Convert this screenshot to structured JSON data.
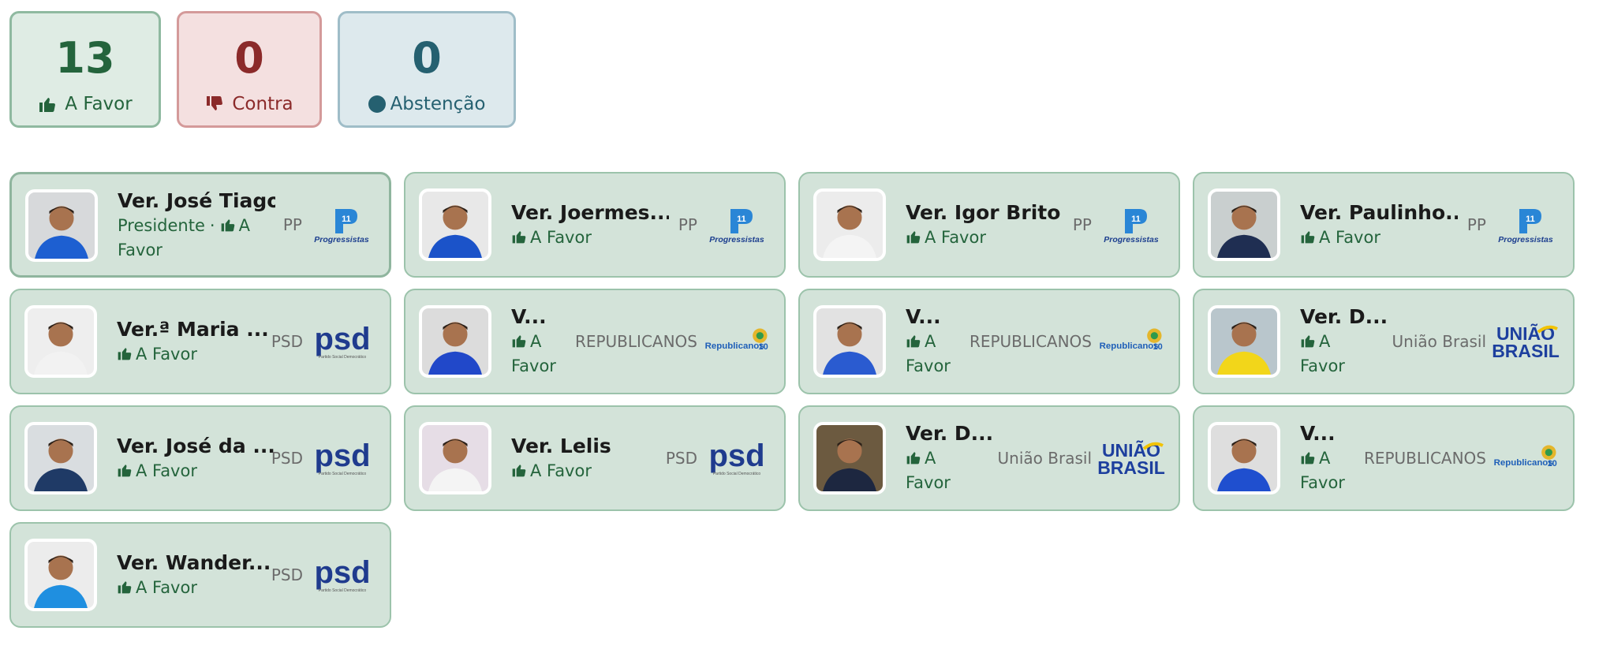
{
  "tally": {
    "favor": {
      "count": "13",
      "label": "A Favor"
    },
    "contra": {
      "count": "0",
      "label": "Contra"
    },
    "abstencao": {
      "count": "0",
      "label": "Abstenção"
    }
  },
  "colors": {
    "favor": "#24643c",
    "contra": "#8b2a2a",
    "abstencao": "#256070",
    "card_bg": "#d3e3d9",
    "card_border": "#9cc3ab"
  },
  "vote_sep": "·",
  "councillors": [
    {
      "name": "Ver. José Tiago",
      "role": "Presidente",
      "vote": "A Favor",
      "party": "PP",
      "logo": "progressistas-logo"
    },
    {
      "name": "Ver. Joermes...",
      "vote": "A Favor",
      "party": "PP",
      "logo": "progressistas-logo"
    },
    {
      "name": "Ver. Igor Brito",
      "vote": "A Favor",
      "party": "PP",
      "logo": "progressistas-logo"
    },
    {
      "name": "Ver. Paulinho...",
      "vote": "A Favor",
      "party": "PP",
      "logo": "progressistas-logo"
    },
    {
      "name": "Ver.ª Maria ...",
      "vote": "A Favor",
      "party": "PSD",
      "logo": "psd-logo"
    },
    {
      "name": "V...",
      "vote": "A Favor",
      "party": "REPUBLICANOS",
      "logo": "republicanos-logo"
    },
    {
      "name": "V...",
      "vote": "A Favor",
      "party": "REPUBLICANOS",
      "logo": "republicanos-logo"
    },
    {
      "name": "Ver. D...",
      "vote": "A Favor",
      "party": "União Brasil",
      "logo": "uniao-brasil-logo"
    },
    {
      "name": "Ver. José da ...",
      "vote": "A Favor",
      "party": "PSD",
      "logo": "psd-logo"
    },
    {
      "name": "Ver. Lelis",
      "vote": "A Favor",
      "party": "PSD",
      "logo": "psd-logo"
    },
    {
      "name": "Ver. D...",
      "vote": "A Favor",
      "party": "União Brasil",
      "logo": "uniao-brasil-logo"
    },
    {
      "name": "V...",
      "vote": "A Favor",
      "party": "REPUBLICANOS",
      "logo": "republicanos-logo"
    },
    {
      "name": "Ver. Wander...",
      "vote": "A Favor",
      "party": "PSD",
      "logo": "psd-logo"
    }
  ],
  "logos": {
    "progressistas": {
      "mark": "11",
      "word": "Progressistas"
    },
    "psd": {
      "mark": "psd",
      "word": "Partido Social Democrático"
    },
    "republicanos": {
      "mark": "Republicanos",
      "num": "10"
    },
    "uniao": {
      "line1": "UNIÃO",
      "line2": "BRASIL"
    }
  }
}
